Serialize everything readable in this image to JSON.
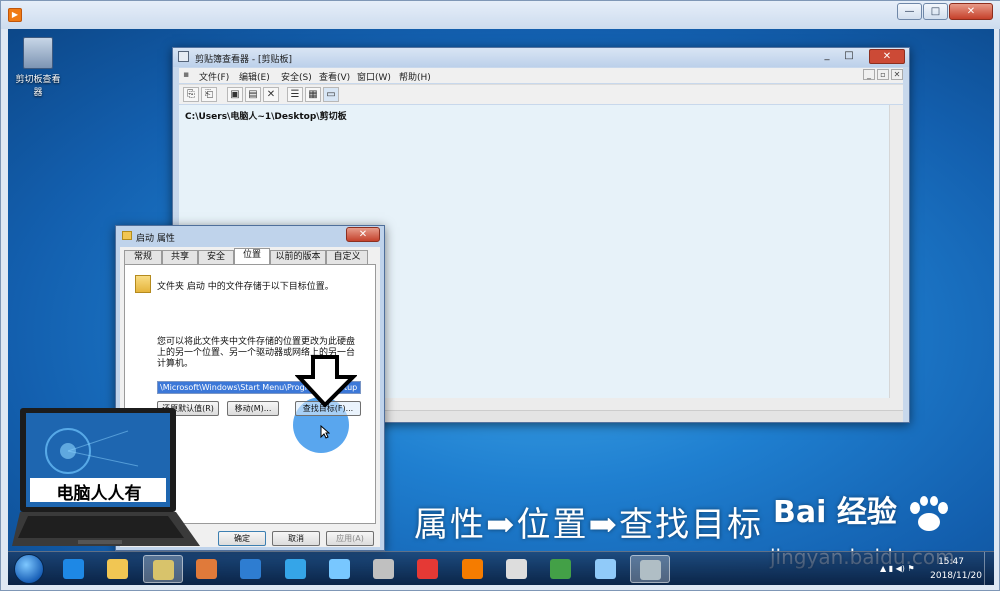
{
  "outer_window": {
    "buttons": {
      "minimize": "—",
      "maximize": "□",
      "close": "✕"
    }
  },
  "desktop_icon": {
    "label": "剪切板查看器"
  },
  "clipboard_viewer": {
    "title": "剪贴簿查看器 - [剪贴板]",
    "menu": [
      "文件(F)",
      "编辑(E)",
      "安全(S)",
      "查看(V)",
      "窗口(W)",
      "帮助(H)"
    ],
    "content_path": "C:\\Users\\电脑人~1\\Desktop\\剪切板"
  },
  "properties_dialog": {
    "title": "启动 属性",
    "tabs": [
      "常规",
      "共享",
      "安全",
      "位置",
      "以前的版本",
      "自定义"
    ],
    "active_tab": "位置",
    "folder_text": "文件夹 启动 中的文件存储于以下目标位置。",
    "description": "您可以将此文件夹中文件存储的位置更改为此硬盘上的另一个位置、另一个驱动器或网络上的另一台计算机。",
    "path_value": "\\Microsoft\\Windows\\Start Menu\\Programs\\Startup",
    "restore_button": "还原默认值(R)",
    "move_button": "移动(M)...",
    "find_target_button": "查找目标(F)...",
    "ok_button": "确定",
    "cancel_button": "取消",
    "apply_button": "应用(A)"
  },
  "laptop_logo": {
    "text": "电脑人人有"
  },
  "caption": "属性➡位置➡查找目标",
  "watermark": {
    "brand": "Bai 经验",
    "url": "jingyan.baidu.com"
  },
  "taskbar": {
    "time": "15:47",
    "date": "2018/11/20",
    "buttons": [
      {
        "name": "ie-icon",
        "color": "#1e88e5"
      },
      {
        "name": "folder-icon",
        "color": "#f1c653"
      },
      {
        "name": "file-explorer-icon",
        "color": "#d8c36b",
        "active": true
      },
      {
        "name": "paint-icon",
        "color": "#e07a3a"
      },
      {
        "name": "media-center-icon",
        "color": "#2e7dd1"
      },
      {
        "name": "browser-icon",
        "color": "#35a5e8"
      },
      {
        "name": "app-icon",
        "color": "#78c7ff"
      },
      {
        "name": "tools-icon",
        "color": "#c0c0c0"
      },
      {
        "name": "game-icon",
        "color": "#e53935"
      },
      {
        "name": "video-player-icon",
        "color": "#f57c00"
      },
      {
        "name": "qq-icon",
        "color": "#dddddd"
      },
      {
        "name": "wechat-icon",
        "color": "#43a047"
      },
      {
        "name": "notepad-icon",
        "color": "#90caf9"
      },
      {
        "name": "clipboard-viewer-icon",
        "color": "#b0bec5",
        "active": true
      }
    ]
  }
}
